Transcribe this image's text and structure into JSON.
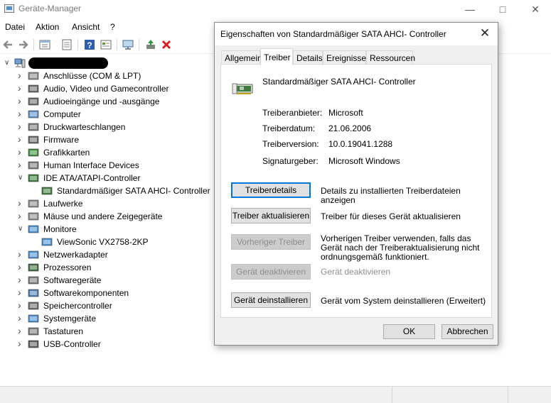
{
  "window": {
    "title": "Geräte-Manager"
  },
  "menu": [
    "Datei",
    "Aktion",
    "Ansicht",
    "?"
  ],
  "toolbar": {
    "icons": [
      "back-icon",
      "forward-icon",
      "properties-icon",
      "help-view-icon",
      "help-icon",
      "view-icon",
      "monitor-icon",
      "update-driver-icon",
      "uninstall-icon"
    ]
  },
  "tree": {
    "computer_name": "",
    "items": [
      {
        "label": "Anschlüsse (COM & LPT)",
        "icon": "port-icon"
      },
      {
        "label": "Audio, Video und Gamecontroller",
        "icon": "speaker-icon"
      },
      {
        "label": "Audioeingänge und -ausgänge",
        "icon": "speaker-icon"
      },
      {
        "label": "Computer",
        "icon": "computer-icon"
      },
      {
        "label": "Druckwarteschlangen",
        "icon": "printer-icon"
      },
      {
        "label": "Firmware",
        "icon": "firmware-icon"
      },
      {
        "label": "Grafikkarten",
        "icon": "display-adapter-icon"
      },
      {
        "label": "Human Interface Devices",
        "icon": "hid-icon"
      },
      {
        "label": "IDE ATA/ATAPI-Controller",
        "icon": "controller-icon",
        "expanded": true
      },
      {
        "label": "Standardmäßiger SATA AHCI- Controller",
        "icon": "controller-icon",
        "child": true
      },
      {
        "label": "Laufwerke",
        "icon": "drive-icon"
      },
      {
        "label": "Mäuse und andere Zeigegeräte",
        "icon": "mouse-icon"
      },
      {
        "label": "Monitore",
        "icon": "monitor-icon",
        "expanded": true
      },
      {
        "label": "ViewSonic VX2758-2KP",
        "icon": "monitor-icon",
        "child": true
      },
      {
        "label": "Netzwerkadapter",
        "icon": "network-icon"
      },
      {
        "label": "Prozessoren",
        "icon": "cpu-icon"
      },
      {
        "label": "Softwaregeräte",
        "icon": "software-icon"
      },
      {
        "label": "Softwarekomponenten",
        "icon": "software-component-icon"
      },
      {
        "label": "Speichercontroller",
        "icon": "storage-icon"
      },
      {
        "label": "Systemgeräte",
        "icon": "system-icon"
      },
      {
        "label": "Tastaturen",
        "icon": "keyboard-icon"
      },
      {
        "label": "USB-Controller",
        "icon": "usb-icon"
      }
    ]
  },
  "dialog": {
    "title": "Eigenschaften von Standardmäßiger SATA AHCI- Controller",
    "tabs": [
      "Allgemein",
      "Treiber",
      "Details",
      "Ereignisse",
      "Ressourcen"
    ],
    "active_tab": "Treiber",
    "device_name": "Standardmäßiger SATA AHCI- Controller",
    "props": [
      {
        "label": "Treiberanbieter:",
        "value": "Microsoft"
      },
      {
        "label": "Treiberdatum:",
        "value": "21.06.2006"
      },
      {
        "label": "Treiberversion:",
        "value": "10.0.19041.1288"
      },
      {
        "label": "Signaturgeber:",
        "value": "Microsoft Windows"
      }
    ],
    "actions": [
      {
        "button": "Treiberdetails",
        "desc": "Details zu installierten Treiberdateien anzeigen",
        "enabled": true
      },
      {
        "button": "Treiber aktualisieren",
        "desc": "Treiber für dieses Gerät aktualisieren",
        "enabled": true
      },
      {
        "button": "Vorheriger Treiber",
        "desc": "Vorherigen Treiber verwenden, falls das Gerät nach der Treiberaktualisierung nicht ordnungsgemäß funktioniert.",
        "enabled": false
      },
      {
        "button": "Gerät deaktivieren",
        "desc": "Gerät deaktivieren",
        "enabled": false
      },
      {
        "button": "Gerät deinstallieren",
        "desc": "Gerät vom System deinstallieren (Erweitert)",
        "enabled": true
      }
    ],
    "ok": "OK",
    "cancel": "Abbrechen"
  },
  "colors": {
    "accent": "#0078d7",
    "disabled_text": "#8e8e8e"
  }
}
